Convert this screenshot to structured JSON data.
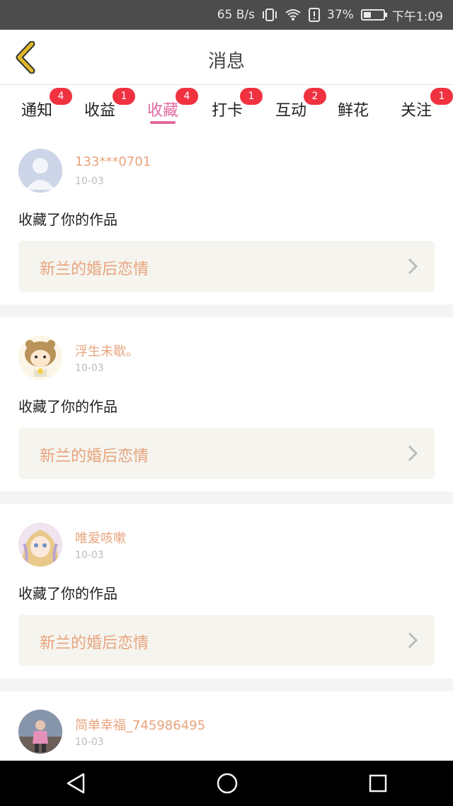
{
  "status_bar": {
    "network_speed": "65 B/s",
    "battery_percent": "37%",
    "time": "下午1:09",
    "icons": [
      "vibrate-icon",
      "wifi-icon",
      "sim-alert-icon",
      "battery-charging-icon"
    ]
  },
  "header": {
    "title": "消息",
    "back_icon": "chevron-left-icon"
  },
  "tabs": [
    {
      "label": "通知",
      "badge": "4"
    },
    {
      "label": "收益",
      "badge": "1"
    },
    {
      "label": "收藏",
      "badge": "4",
      "active": true
    },
    {
      "label": "打卡",
      "badge": "1"
    },
    {
      "label": "互动",
      "badge": "2"
    },
    {
      "label": "鲜花",
      "badge": ""
    },
    {
      "label": "关注",
      "badge": "1"
    }
  ],
  "messages": [
    {
      "username": "133***0701",
      "date": "10-03",
      "action": "收藏了你的作品",
      "work": "新兰的婚后恋情",
      "avatar": "default-avatar"
    },
    {
      "username": "浮生未歇。",
      "date": "10-03",
      "action": "收藏了你的作品",
      "work": "新兰的婚后恋情",
      "avatar": "cartoon-avatar"
    },
    {
      "username": "唯爱咳嗽",
      "date": "10-03",
      "action": "收藏了你的作品",
      "work": "新兰的婚后恋情",
      "avatar": "anime-avatar"
    },
    {
      "username": "简单幸福_745986495",
      "date": "10-03",
      "action": "",
      "work": "",
      "avatar": "photo-avatar"
    }
  ],
  "colors": {
    "accent_pink": "#e06aa0",
    "badge_red": "#f0313f",
    "name_orange": "#e8a37d",
    "back_yellow": "#e0b92a"
  },
  "nav_bar": {
    "icons": [
      "back-triangle-icon",
      "home-circle-icon",
      "recents-square-icon"
    ]
  }
}
